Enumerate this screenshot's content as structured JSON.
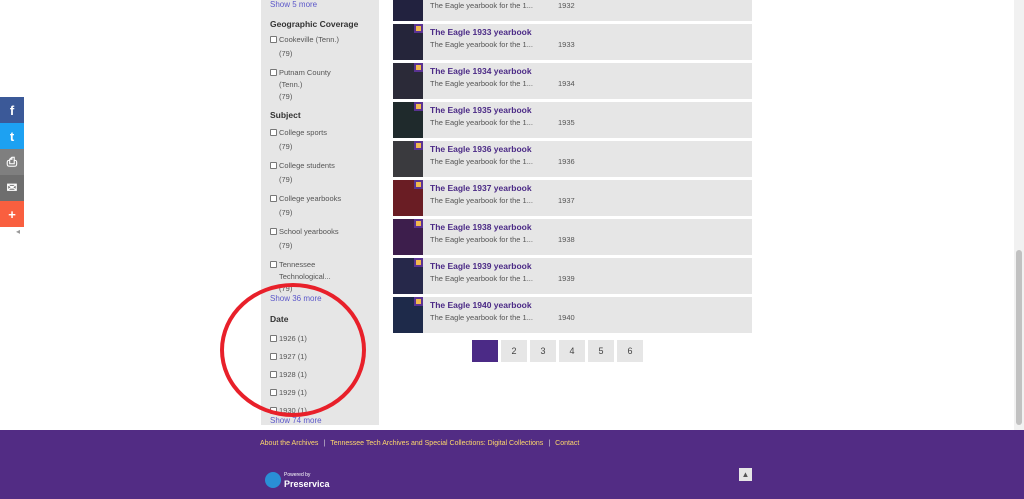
{
  "share": {
    "items": [
      {
        "name": "facebook",
        "glyph": "f",
        "color": "#3b5998"
      },
      {
        "name": "twitter",
        "glyph": "t",
        "color": "#1da1f2"
      },
      {
        "name": "print",
        "glyph": "⎙",
        "color": "#7f7f7f"
      },
      {
        "name": "email",
        "glyph": "✉",
        "color": "#6e6e6e"
      },
      {
        "name": "more",
        "glyph": "+",
        "color": "#f95f3f"
      }
    ],
    "collapse_glyph": "◂"
  },
  "sidebar": {
    "top_more": "Show 5 more",
    "geographic": {
      "heading": "Geographic Coverage",
      "options": [
        {
          "label": "Cookeville (Tenn.)",
          "count": "(79)"
        },
        {
          "label": "Putnam County (Tenn.)",
          "count": "(79)"
        }
      ]
    },
    "subject": {
      "heading": "Subject",
      "options": [
        {
          "label": "College sports",
          "count": "(79)"
        },
        {
          "label": "College students",
          "count": "(79)"
        },
        {
          "label": "College yearbooks",
          "count": "(79)"
        },
        {
          "label": "School yearbooks",
          "count": "(79)"
        },
        {
          "label": "Tennessee Technological...",
          "count": "(79)"
        }
      ],
      "more": "Show 36 more"
    },
    "date": {
      "heading": "Date",
      "options": [
        {
          "label": "1926 (1)"
        },
        {
          "label": "1927 (1)"
        },
        {
          "label": "1928 (1)"
        },
        {
          "label": "1929 (1)"
        },
        {
          "label": "1930 (1)"
        }
      ],
      "more": "Show 74 more"
    }
  },
  "results": [
    {
      "title": "",
      "desc": "The Eagle yearbook for the 1...",
      "year": "1932"
    },
    {
      "title": "The Eagle 1933 yearbook",
      "desc": "The Eagle yearbook for the 1...",
      "year": "1933"
    },
    {
      "title": "The Eagle 1934 yearbook",
      "desc": "The Eagle yearbook for the 1...",
      "year": "1934"
    },
    {
      "title": "The Eagle 1935 yearbook",
      "desc": "The Eagle yearbook for the 1...",
      "year": "1935"
    },
    {
      "title": "The Eagle 1936 yearbook",
      "desc": "The Eagle yearbook for the 1...",
      "year": "1936"
    },
    {
      "title": "The Eagle 1937 yearbook",
      "desc": "The Eagle yearbook for the 1...",
      "year": "1937"
    },
    {
      "title": "The Eagle 1938 yearbook",
      "desc": "The Eagle yearbook for the 1...",
      "year": "1938"
    },
    {
      "title": "The Eagle 1939 yearbook",
      "desc": "The Eagle yearbook for the 1...",
      "year": "1939"
    },
    {
      "title": "The Eagle 1940 yearbook",
      "desc": "The Eagle yearbook for the 1...",
      "year": "1940"
    }
  ],
  "pagination": {
    "current": "",
    "pages": [
      "2",
      "3",
      "4",
      "5",
      "6"
    ]
  },
  "footer": {
    "links": [
      "About the Archives",
      "Tennessee Tech Archives and Special Collections: Digital Collections",
      "Contact"
    ],
    "separator": "|",
    "powered_small": "Powered by",
    "powered_brand": "Preservica",
    "to_top_glyph": "▲"
  },
  "colors": {
    "accent_purple": "#522c84",
    "link_blue": "#5b57c9",
    "annotation_red": "#e8202a"
  }
}
